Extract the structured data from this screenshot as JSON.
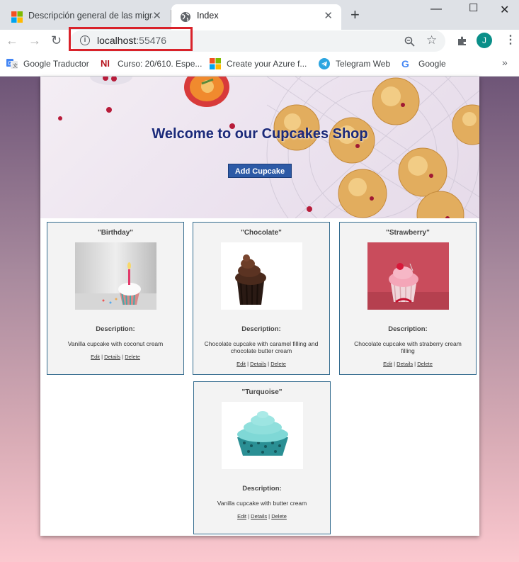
{
  "browser": {
    "tabs": [
      {
        "title": "Descripción general de las migraci"
      },
      {
        "title": "Index"
      }
    ],
    "address": {
      "host": "localhost",
      "port": ":55476"
    },
    "avatar_initial": "J",
    "bookmarks": [
      {
        "label": "Google Traductor",
        "icon": "google-translate-icon"
      },
      {
        "label": "Curso: 20/610. Espe...",
        "icon": "ni-icon"
      },
      {
        "label": "Create your Azure f...",
        "icon": "microsoft-icon"
      },
      {
        "label": "Telegram Web",
        "icon": "telegram-icon"
      },
      {
        "label": "Google",
        "icon": "google-icon"
      }
    ]
  },
  "page": {
    "hero_title": "Welcome to our Cupcakes Shop",
    "add_button": "Add Cupcake",
    "description_label": "Description:",
    "link_edit": "Edit",
    "link_details": "Details",
    "link_delete": "Delete",
    "cupcakes": [
      {
        "name": "\"Birthday\"",
        "description": "Vanilla cupcake with coconut cream"
      },
      {
        "name": "\"Chocolate\"",
        "description": "Chocolate cupcake with caramel filling and chocolate butter cream"
      },
      {
        "name": "\"Strawberry\"",
        "description": "Chocolate cupcake with straberry cream filling"
      },
      {
        "name": "\"Turquoise\"",
        "description": "Vanilla cupcake with butter cream"
      }
    ]
  },
  "colors": {
    "accent": "#2d5aa6",
    "title": "#1b2a7a",
    "highlight": "#d9222a"
  }
}
